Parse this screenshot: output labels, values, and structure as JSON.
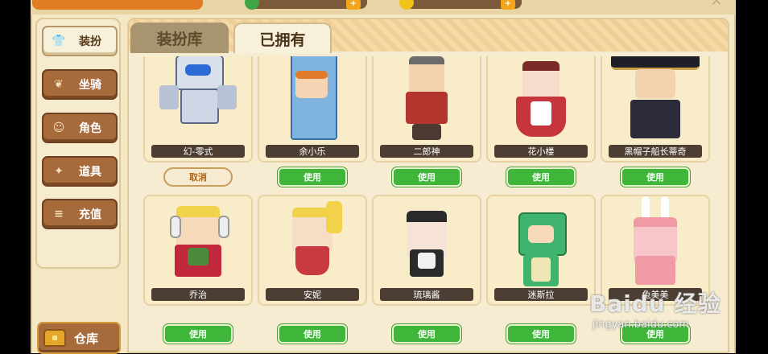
{
  "sidebar": {
    "items": [
      {
        "label": "装扮",
        "icon": "shirt-icon",
        "active": true
      },
      {
        "label": "坐骑",
        "icon": "mount-icon",
        "active": false
      },
      {
        "label": "角色",
        "icon": "character-icon",
        "active": false
      },
      {
        "label": "道具",
        "icon": "wand-icon",
        "active": false
      },
      {
        "label": "充值",
        "icon": "coin-stack-icon",
        "active": false
      }
    ],
    "storage_label": "仓库"
  },
  "tabs": [
    {
      "label": "装扮库",
      "active": false
    },
    {
      "label": "已拥有",
      "active": true
    }
  ],
  "skins": [
    {
      "name": "幻-零式",
      "action": "取消",
      "equipped": true,
      "theme": "#cfd6e6",
      "accent": "#2c6ad6"
    },
    {
      "name": "余小乐",
      "action": "使用",
      "equipped": false,
      "theme": "#7fb3e0",
      "accent": "#3a6ea5"
    },
    {
      "name": "二郎神",
      "action": "使用",
      "equipped": false,
      "theme": "#b4342e",
      "accent": "#4a3a32"
    },
    {
      "name": "花小楼",
      "action": "使用",
      "equipped": false,
      "theme": "#c7353c",
      "accent": "#6d2b1e"
    },
    {
      "name": "黑帽子船长蒂奇",
      "action": "使用",
      "equipped": false,
      "theme": "#2b2b3a",
      "accent": "#c9a24a"
    },
    {
      "name": "乔治",
      "action": "使用",
      "equipped": false,
      "theme": "#c2283c",
      "accent": "#f2d24a"
    },
    {
      "name": "安妮",
      "action": "使用",
      "equipped": false,
      "theme": "#c83a3f",
      "accent": "#f2d24a"
    },
    {
      "name": "琉璃酱",
      "action": "使用",
      "equipped": false,
      "theme": "#2a2a2a",
      "accent": "#f1f1f1"
    },
    {
      "name": "迷斯拉",
      "action": "使用",
      "equipped": false,
      "theme": "#3fb46e",
      "accent": "#f0e6b5"
    },
    {
      "name": "兔美美",
      "action": "使用",
      "equipped": false,
      "theme": "#f09aa4",
      "accent": "#ffffff"
    }
  ],
  "watermark": {
    "brand": "Baidu 经验",
    "url": "jingyan.baidu.com"
  },
  "colors": {
    "frame": "#f3e7c4",
    "button_brown": "#a66a3b",
    "use_green": "#3fb53a"
  }
}
